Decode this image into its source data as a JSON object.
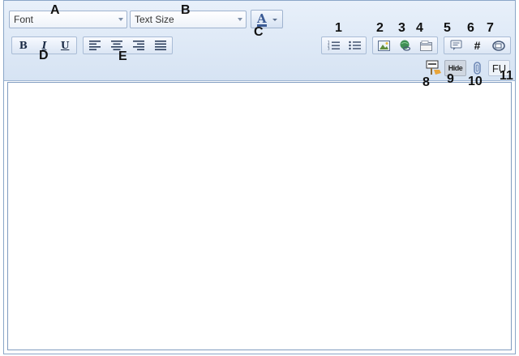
{
  "toolbar": {
    "font_dropdown": {
      "value": "Font"
    },
    "size_dropdown": {
      "value": "Text Size"
    },
    "font_color_button": {
      "glyph": "A",
      "accent": "#3b5b95"
    },
    "format_buttons": [
      {
        "name": "bold",
        "glyph": "B",
        "icon": "bold-icon"
      },
      {
        "name": "italic",
        "glyph": "I",
        "icon": "italic-icon"
      },
      {
        "name": "underline",
        "glyph": "U",
        "icon": "underline-icon"
      }
    ],
    "align_buttons": [
      {
        "name": "align-left",
        "icon": "align-left-icon"
      },
      {
        "name": "align-center",
        "icon": "align-center-icon"
      },
      {
        "name": "align-right",
        "icon": "align-right-icon"
      },
      {
        "name": "justify",
        "icon": "justify-icon"
      }
    ],
    "list_buttons": [
      {
        "name": "ordered-list",
        "icon": "ordered-list-icon"
      },
      {
        "name": "unordered-list",
        "icon": "unordered-list-icon"
      }
    ],
    "media_buttons": [
      {
        "name": "insert-image",
        "icon": "image-icon"
      },
      {
        "name": "insert-link",
        "icon": "link-globe-icon"
      },
      {
        "name": "insert-table",
        "icon": "table-icon"
      }
    ],
    "misc_buttons": [
      {
        "name": "quote",
        "icon": "quote-icon"
      },
      {
        "name": "hashtag",
        "glyph": "#",
        "icon": "hash-icon"
      },
      {
        "name": "email",
        "icon": "email-icon"
      }
    ],
    "row2_buttons": [
      {
        "name": "spoiler",
        "icon": "spoiler-icon"
      },
      {
        "name": "hide",
        "glyph": "Hide",
        "icon": "hide-icon"
      },
      {
        "name": "attachment",
        "icon": "attachment-icon"
      },
      {
        "name": "fu",
        "glyph": "FU",
        "icon": "fu-icon"
      }
    ]
  },
  "annotations": {
    "a": "A",
    "b": "B",
    "c": "C",
    "d": "D",
    "e": "E",
    "n1": "1",
    "n2": "2",
    "n3": "3",
    "n4": "4",
    "n5": "5",
    "n6": "6",
    "n7": "7",
    "n8": "8",
    "n9": "9",
    "n10": "10",
    "n11": "11"
  },
  "editor": {
    "content": ""
  }
}
